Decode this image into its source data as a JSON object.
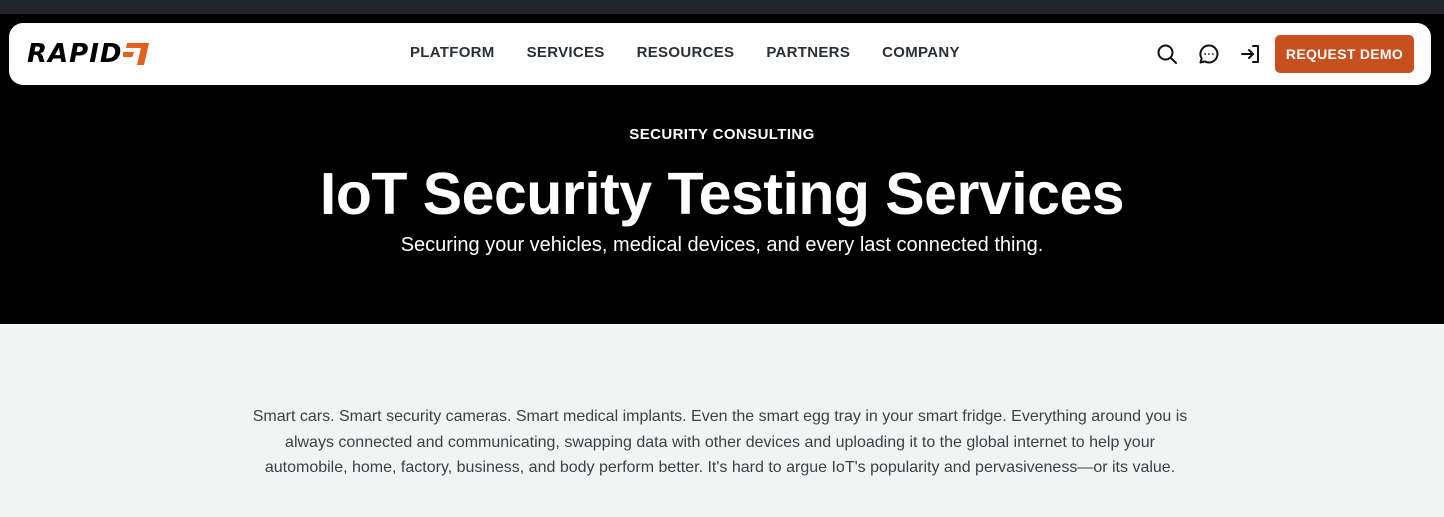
{
  "brand": {
    "name": "RAPID",
    "mark": "7"
  },
  "nav": {
    "links": [
      "PLATFORM",
      "SERVICES",
      "RESOURCES",
      "PARTNERS",
      "COMPANY"
    ],
    "cta_label": "REQUEST DEMO"
  },
  "hero": {
    "eyebrow": "SECURITY CONSULTING",
    "title": "IoT Security Testing Services",
    "subtitle": "Securing your vehicles, medical devices, and every last connected thing."
  },
  "content": {
    "paragraph": "Smart cars. Smart security cameras. Smart medical implants. Even the smart egg tray in your smart fridge. Everything around you is always connected and communicating, swapping data with other devices and uploading it to the global internet to help your automobile, home, factory, business, and body perform better. It's hard to argue IoT's popularity and pervasiveness—or its value."
  },
  "colors": {
    "accent": "#c8501f",
    "hero_bg": "#000000",
    "content_bg": "#f2f4f4",
    "top_strip": "#20262c"
  },
  "icons": [
    "search-icon",
    "chat-icon",
    "sign-in-icon"
  ]
}
